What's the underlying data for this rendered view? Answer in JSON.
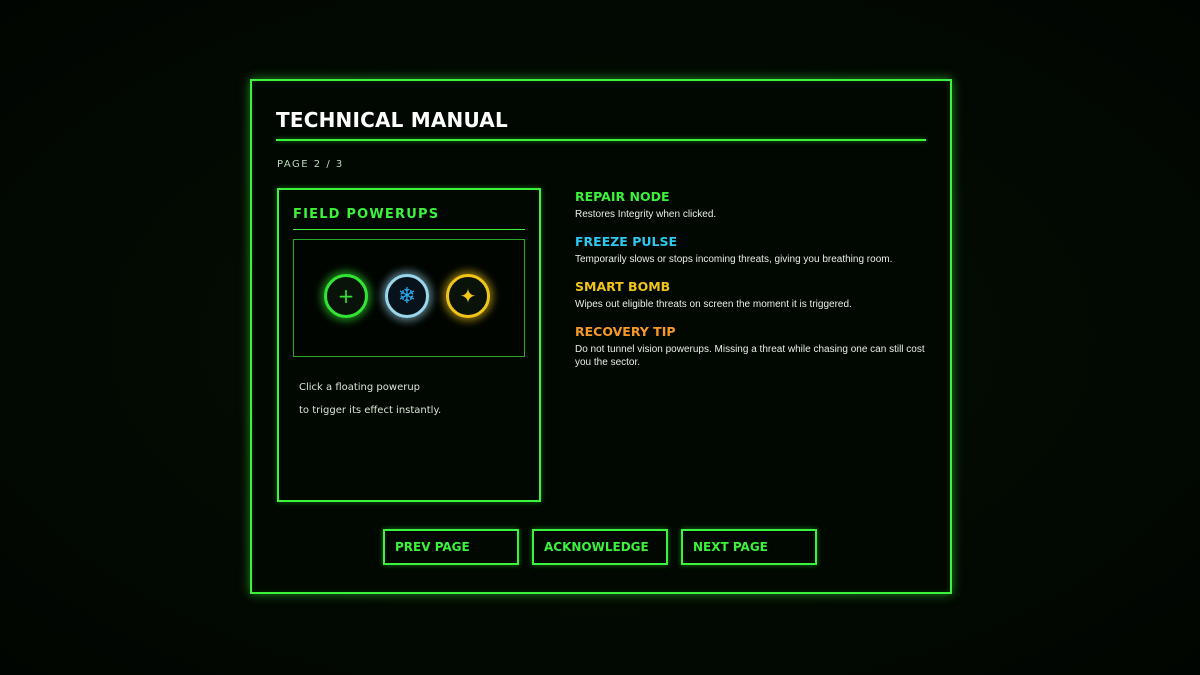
{
  "manual": {
    "title": "TECHNICAL MANUAL",
    "page_indicator": "PAGE 2 / 3"
  },
  "powerups_card": {
    "title": "FIELD POWERUPS",
    "icons": [
      {
        "name": "plus-icon",
        "glyph": "+",
        "color": "#33e433"
      },
      {
        "name": "snowflake-icon",
        "glyph": "❄",
        "color": "#2aa8ee"
      },
      {
        "name": "sparkle-icon",
        "glyph": "✦",
        "color": "#f0c419"
      }
    ],
    "caption_line1": "Click a floating powerup",
    "caption_line2": "to trigger its effect instantly."
  },
  "entries": [
    {
      "heading": "REPAIR NODE",
      "description": "Restores Integrity when clicked.",
      "color": "#3cf23c"
    },
    {
      "heading": "FREEZE PULSE",
      "description": "Temporarily slows or stops incoming threats, giving you breathing room.",
      "color": "#2ec8f0"
    },
    {
      "heading": "SMART BOMB",
      "description": "Wipes out eligible threats on screen the moment it is triggered.",
      "color": "#f0c419"
    },
    {
      "heading": "RECOVERY TIP",
      "description": "Do not tunnel vision powerups. Missing a threat while chasing one can still cost you the sector.",
      "color": "#f59a2a"
    }
  ],
  "buttons": {
    "prev": "PREV PAGE",
    "acknowledge": "ACKNOWLEDGE",
    "next": "NEXT PAGE"
  },
  "theme": {
    "accent": "#3cf23c",
    "background": "#020902"
  }
}
